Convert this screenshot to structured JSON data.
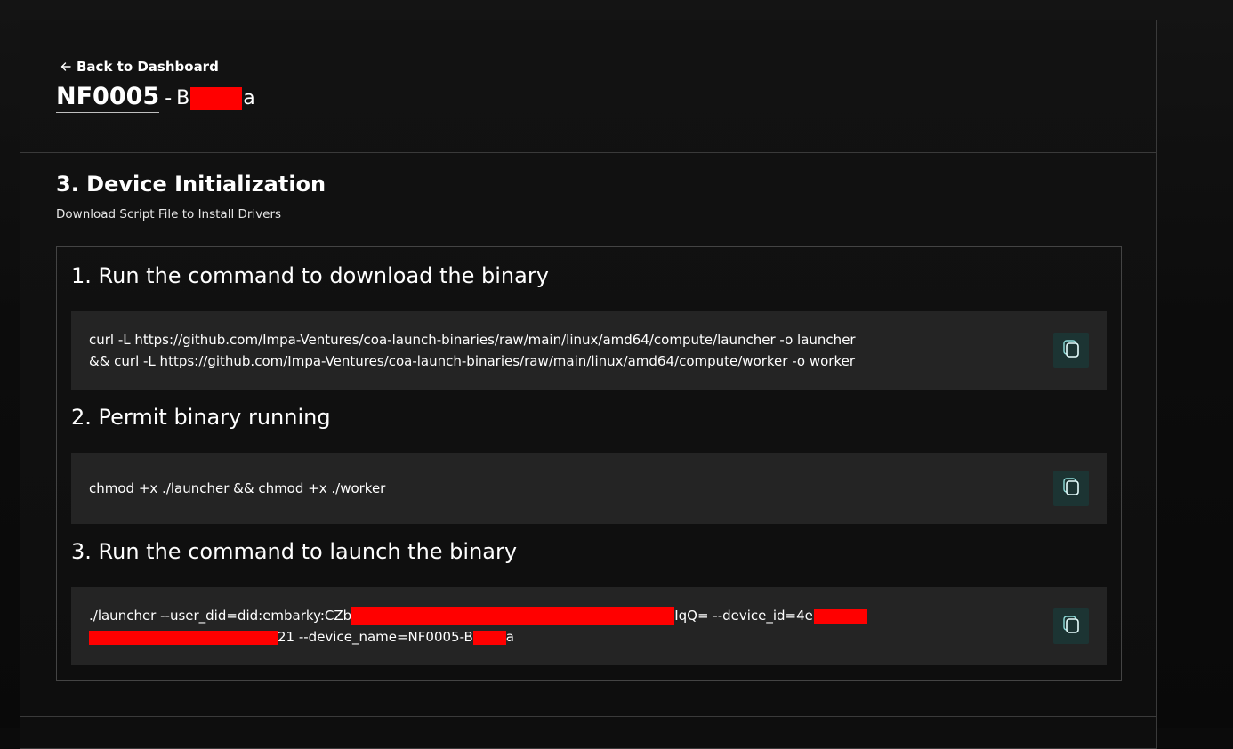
{
  "header": {
    "back_label": "Back to Dashboard",
    "device_id": "NF0005",
    "separator": "-",
    "device_name_start": "B",
    "device_name_end": "a"
  },
  "section": {
    "title": "3. Device Initialization",
    "subtitle": "Download Script File to Install Drivers"
  },
  "steps": [
    {
      "title": "1. Run the command to download the binary",
      "lines": [
        "curl -L https://github.com/Impa-Ventures/coa-launch-binaries/raw/main/linux/amd64/compute/launcher -o launcher",
        "&& curl -L https://github.com/Impa-Ventures/coa-launch-binaries/raw/main/linux/amd64/compute/worker -o worker"
      ]
    },
    {
      "title": "2. Permit binary running",
      "lines": [
        "chmod +x ./launcher && chmod +x ./worker"
      ]
    },
    {
      "title": "3. Run the command to launch the binary",
      "line1_a": "./launcher --user_did=did:embarky:CZb",
      "line1_b": "IqQ= --device_id=4e",
      "line2_a": "21 --device_name=NF0005-B",
      "line2_b": "a"
    }
  ],
  "colors": {
    "accent": "#6ed3d0",
    "copy_bg": "#1c3433",
    "code_bg": "#242424",
    "redaction": "#ff0000"
  },
  "icons": {
    "back": "arrow-left-icon",
    "copy": "copy-icon"
  }
}
